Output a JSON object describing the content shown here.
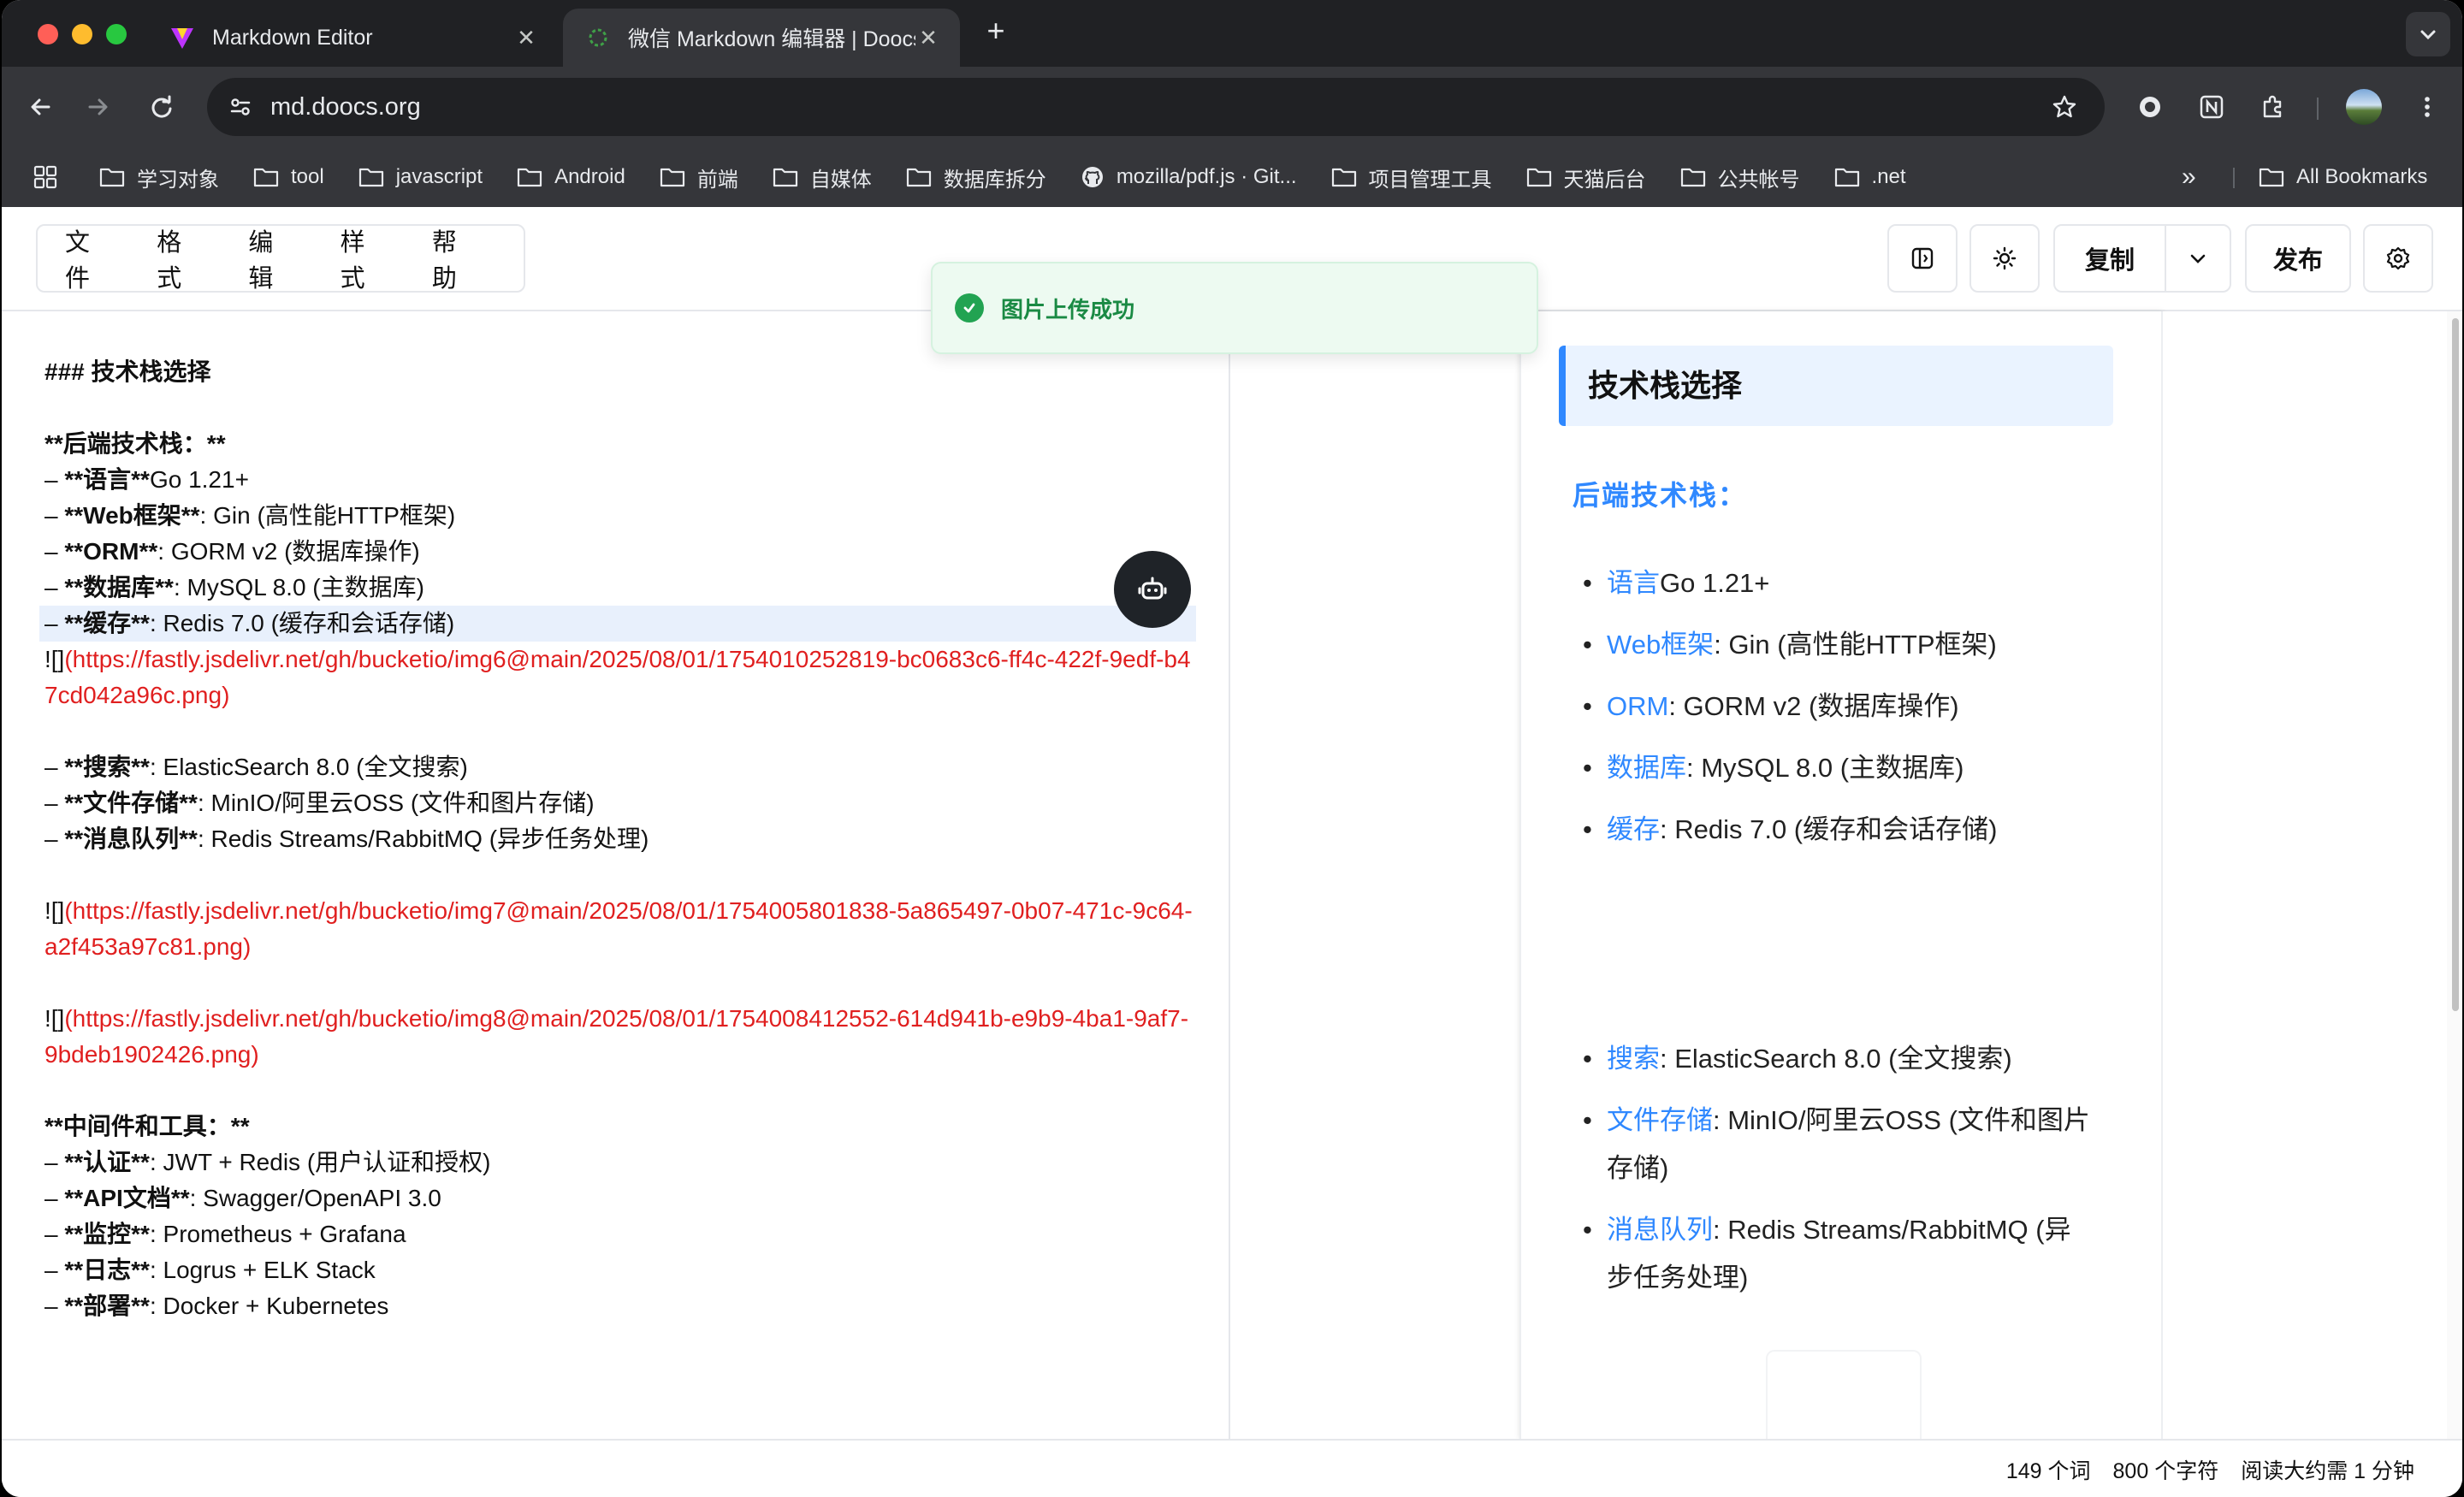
{
  "browser": {
    "tabs": [
      {
        "title": "Markdown Editor",
        "active": false
      },
      {
        "title": "微信 Markdown 编辑器 | Doocs",
        "active": true
      }
    ],
    "url": "md.doocs.org",
    "bookmarks": [
      "学习对象",
      "tool",
      "javascript",
      "Android",
      "前端",
      "自媒体",
      "数据库拆分",
      "mozilla/pdf.js · Git...",
      "项目管理工具",
      "天猫后台",
      "公共帐号",
      ".net"
    ],
    "more_bookmarks": "»",
    "all_bookmarks": "All Bookmarks"
  },
  "menu": {
    "file": "文件",
    "format": "格式",
    "edit": "编辑",
    "style": "样式",
    "help": "帮助"
  },
  "header": {
    "copy": "复制",
    "publish": "发布"
  },
  "toast": {
    "message": "图片上传成功"
  },
  "editor": {
    "lines": [
      {
        "prefix": "",
        "bold": "### 技术栈选择",
        "text": ""
      },
      {
        "prefix": "",
        "bold": "",
        "text": ""
      },
      {
        "prefix": "",
        "bold": "**后端技术栈：**",
        "text": ""
      },
      {
        "prefix": "– ",
        "bold": "**语言**",
        "text": "Go 1.21+"
      },
      {
        "prefix": "– ",
        "bold": "**Web框架**",
        "text": ": Gin (高性能HTTP框架)"
      },
      {
        "prefix": "– ",
        "bold": "**ORM**",
        "text": ": GORM v2 (数据库操作)"
      },
      {
        "prefix": "– ",
        "bold": "**数据库**",
        "text": ": MySQL 8.0 (主数据库)"
      },
      {
        "prefix": "– ",
        "bold": "**缓存**",
        "text": ": Redis 7.0 (缓存和会话存储)"
      }
    ],
    "image1": {
      "prefix": "![]",
      "url": "(https://fastly.jsdelivr.net/gh/bucketio/img6@main/2025/08/01/1754010252819-bc0683c6-ff4c-422f-9edf-b47cd042a96c.png)"
    },
    "lines2": [
      {
        "prefix": "– ",
        "bold": "**搜索**",
        "text": ": ElasticSearch 8.0 (全文搜索)"
      },
      {
        "prefix": "– ",
        "bold": "**文件存储**",
        "text": ": MinIO/阿里云OSS (文件和图片存储)"
      },
      {
        "prefix": "– ",
        "bold": "**消息队列**",
        "text": ": Redis Streams/RabbitMQ (异步任务处理)"
      }
    ],
    "image2": {
      "prefix": "![]",
      "url": "(https://fastly.jsdelivr.net/gh/bucketio/img7@main/2025/08/01/1754005801838-5a865497-0b07-471c-9c64-a2f453a97c81.png)"
    },
    "image3": {
      "prefix": "![]",
      "url": "(https://fastly.jsdelivr.net/gh/bucketio/img8@main/2025/08/01/1754008412552-614d941b-e9b9-4ba1-9af7-9bdeb1902426.png)"
    },
    "lines3": [
      {
        "prefix": "",
        "bold": "**中间件和工具：**",
        "text": ""
      },
      {
        "prefix": "– ",
        "bold": "**认证**",
        "text": ": JWT + Redis (用户认证和授权)"
      },
      {
        "prefix": "– ",
        "bold": "**API文档**",
        "text": ": Swagger/OpenAPI 3.0"
      },
      {
        "prefix": "– ",
        "bold": "**监控**",
        "text": ": Prometheus + Grafana"
      },
      {
        "prefix": "– ",
        "bold": "**日志**",
        "text": ": Logrus + ELK Stack"
      },
      {
        "prefix": "– ",
        "bold": "**部署**",
        "text": ": Docker + Kubernetes"
      }
    ]
  },
  "preview": {
    "heading": "技术栈选择",
    "strong": "后端技术栈：",
    "list1": [
      {
        "key": "语言",
        "text": "Go 1.21+"
      },
      {
        "key": "Web框架",
        "text": ": Gin (高性能HTTP框架)"
      },
      {
        "key": "ORM",
        "text": ": GORM v2 (数据库操作)"
      },
      {
        "key": "数据库",
        "text": ": MySQL 8.0 (主数据库)"
      },
      {
        "key": "缓存",
        "text": ": Redis 7.0 (缓存和会话存储)"
      }
    ],
    "list2": [
      {
        "key": "搜索",
        "text": ": ElasticSearch 8.0 (全文搜索)"
      },
      {
        "key": "文件存储",
        "text": ": MinIO/阿里云OSS (文件和图片存储)"
      },
      {
        "key": "消息队列",
        "text": ": Redis Streams/RabbitMQ (异步任务处理)"
      }
    ]
  },
  "footer": {
    "words": "149 个词",
    "chars": "800 个字符",
    "read": "阅读大约需 1 分钟"
  },
  "colors": {
    "accent": "#2f88ff",
    "link_red": "#e01f1f",
    "toast_green": "#22a352"
  }
}
